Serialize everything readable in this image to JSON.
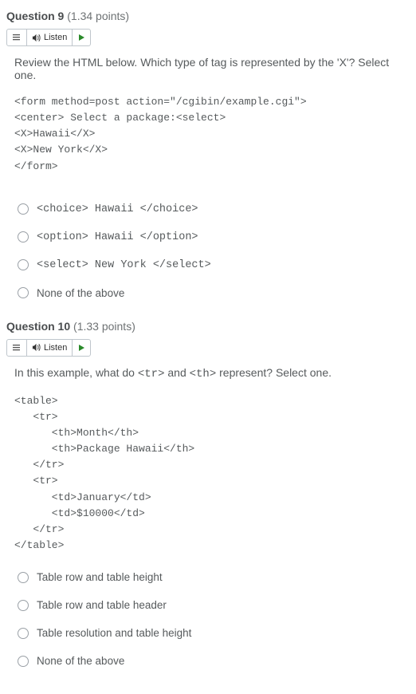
{
  "listen_label": "Listen",
  "q9": {
    "title": "Question 9",
    "points": "(1.34 points)",
    "prompt": "Review the HTML below. Which type of tag is represented by the 'X'? Select one.",
    "code": "<form method=post action=\"/cgibin/example.cgi\">\n<center> Select a package:<select>\n<X>Hawaii</X>\n<X>New York</X>\n</form>",
    "choices": [
      "<choice> Hawaii </choice>",
      "<option> Hawaii </option>",
      "<select> New York </select>",
      "None of the above"
    ]
  },
  "q10": {
    "title": "Question 10",
    "points": "(1.33 points)",
    "prompt_pre": "In this example, what do ",
    "prompt_code1": "<tr>",
    "prompt_mid": " and ",
    "prompt_code2": "<th>",
    "prompt_post": " represent? Select one.",
    "code": "<table>\n   <tr>\n      <th>Month</th>\n      <th>Package Hawaii</th>\n   </tr>\n   <tr>\n      <td>January</td>\n      <td>$10000</td>\n   </tr>\n</table>",
    "choices": [
      "Table row and table height",
      "Table row and table header",
      "Table resolution and table height",
      "None of the above"
    ]
  }
}
